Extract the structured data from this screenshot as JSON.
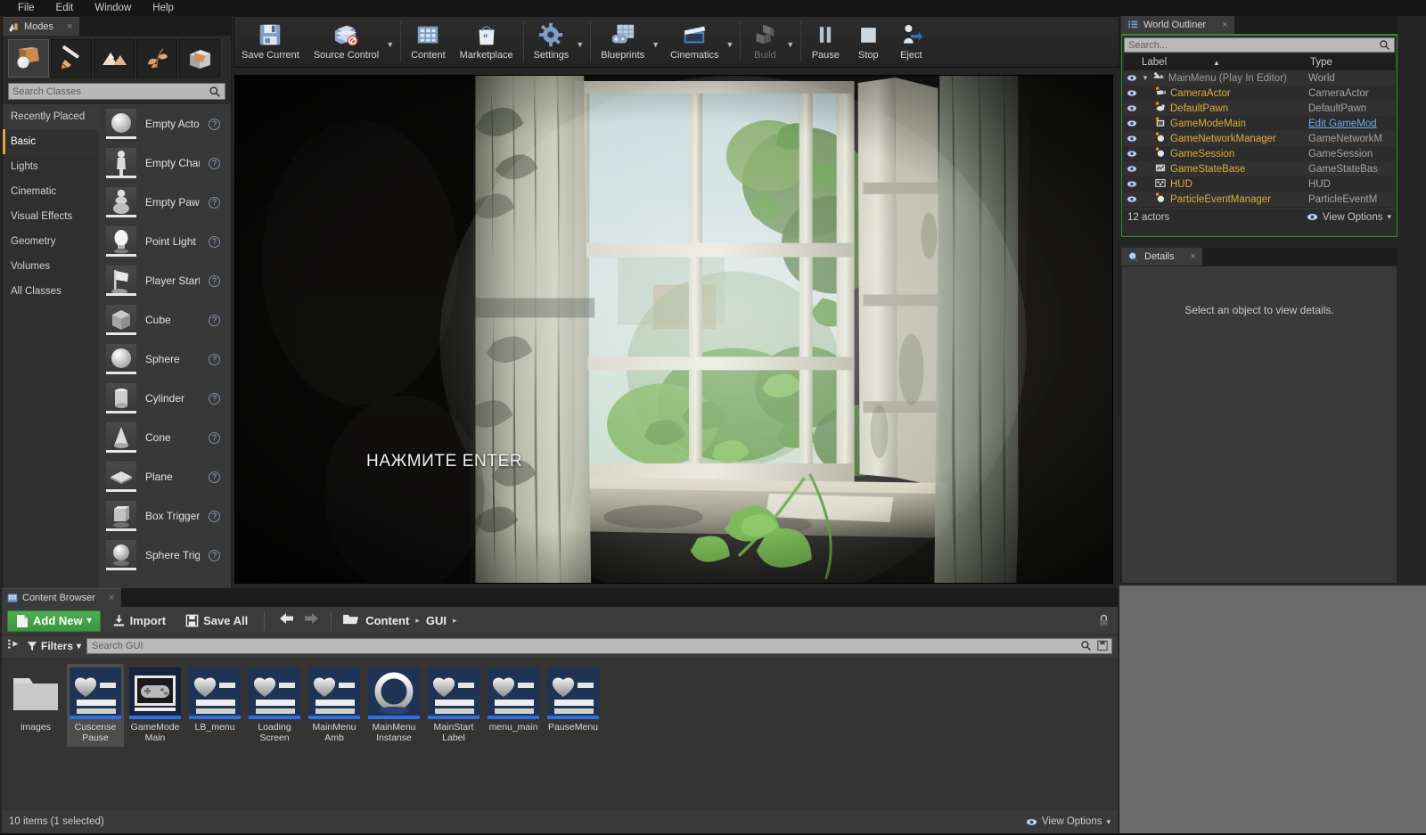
{
  "menu": {
    "items": [
      "File",
      "Edit",
      "Window",
      "Help"
    ]
  },
  "modes_panel": {
    "tab_label": "Modes",
    "tab_icon": "modes-icon",
    "close_icon": "×",
    "mode_buttons": [
      {
        "name": "place-mode",
        "icon": "cube-sphere-icon",
        "active": true
      },
      {
        "name": "paint-mode",
        "icon": "paintbrush-icon",
        "active": false
      },
      {
        "name": "landscape-mode",
        "icon": "mountain-icon",
        "active": false
      },
      {
        "name": "foliage-mode",
        "icon": "leaf-icon",
        "active": false
      },
      {
        "name": "geometry-mode",
        "icon": "brush-editing-icon",
        "active": false
      }
    ],
    "search": {
      "placeholder": "Search Classes",
      "value": "",
      "icon": "search-icon"
    },
    "categories": [
      {
        "label": "Recently Placed",
        "selected": false,
        "hover": true
      },
      {
        "label": "Basic",
        "selected": true,
        "hover": false
      },
      {
        "label": "Lights",
        "selected": false,
        "hover": false
      },
      {
        "label": "Cinematic",
        "selected": false,
        "hover": false
      },
      {
        "label": "Visual Effects",
        "selected": false,
        "hover": false
      },
      {
        "label": "Geometry",
        "selected": false,
        "hover": false
      },
      {
        "label": "Volumes",
        "selected": false,
        "hover": false
      },
      {
        "label": "All Classes",
        "selected": false,
        "hover": false
      }
    ],
    "items": [
      {
        "label": "Empty Actor",
        "icon": "sphere-thumb",
        "help": "?"
      },
      {
        "label": "Empty Charac",
        "icon": "character-thumb",
        "help": "?"
      },
      {
        "label": "Empty Pawn",
        "icon": "pawn-thumb",
        "help": "?"
      },
      {
        "label": "Point Light",
        "icon": "pointlight-thumb",
        "help": "?"
      },
      {
        "label": "Player Start",
        "icon": "playerstart-thumb",
        "help": "?"
      },
      {
        "label": "Cube",
        "icon": "cube-thumb",
        "help": "?"
      },
      {
        "label": "Sphere",
        "icon": "sphere-thumb",
        "help": "?"
      },
      {
        "label": "Cylinder",
        "icon": "cylinder-thumb",
        "help": "?"
      },
      {
        "label": "Cone",
        "icon": "cone-thumb",
        "help": "?"
      },
      {
        "label": "Plane",
        "icon": "plane-thumb",
        "help": "?"
      },
      {
        "label": "Box Trigger",
        "icon": "boxtrigger-thumb",
        "help": "?"
      },
      {
        "label": "Sphere Trigge",
        "icon": "spheretrigger-thumb",
        "help": "?"
      }
    ]
  },
  "toolbar": {
    "buttons": [
      {
        "label": "Save Current",
        "icon": "save-icon",
        "dropdown": false,
        "disabled": false
      },
      {
        "label": "Source Control",
        "icon": "source-control-icon",
        "dropdown": true,
        "disabled": false
      },
      {
        "label": "Content",
        "icon": "content-icon",
        "dropdown": false,
        "disabled": false
      },
      {
        "label": "Marketplace",
        "icon": "marketplace-icon",
        "dropdown": false,
        "disabled": false
      },
      {
        "label": "Settings",
        "icon": "settings-gear-icon",
        "dropdown": true,
        "disabled": false
      },
      {
        "label": "Blueprints",
        "icon": "blueprints-icon",
        "dropdown": true,
        "disabled": false
      },
      {
        "label": "Cinematics",
        "icon": "cinematics-clapperboard-icon",
        "dropdown": true,
        "disabled": false
      },
      {
        "label": "Build",
        "icon": "build-icon",
        "dropdown": true,
        "disabled": true
      },
      {
        "label": "Pause",
        "icon": "pause-icon",
        "dropdown": false,
        "disabled": false
      },
      {
        "label": "Stop",
        "icon": "stop-icon",
        "dropdown": false,
        "disabled": false
      },
      {
        "label": "Eject",
        "icon": "eject-icon",
        "dropdown": false,
        "disabled": false
      }
    ]
  },
  "viewport": {
    "overlay_text": "НАЖМИТЕ ENTER",
    "scene_description": "abandoned room interior with sunlit window, lace curtains and green vine leaves"
  },
  "outliner": {
    "tab_label": "World Outliner",
    "tab_icon": "outliner-list-icon",
    "close_icon": "×",
    "search": {
      "placeholder": "Search...",
      "value": "",
      "icon": "search-icon"
    },
    "columns": {
      "label": "Label",
      "type": "Type",
      "sort_caret": "▲"
    },
    "rows": [
      {
        "label": "MainMenu (Play In Editor)",
        "type": "World",
        "level": 0,
        "icon": "world-icon",
        "eye": "eye-icon",
        "type_link": false
      },
      {
        "label": "CameraActor",
        "type": "CameraActor",
        "level": 1,
        "icon": "camera-icon",
        "eye": "eye-icon",
        "type_link": false
      },
      {
        "label": "DefaultPawn",
        "type": "DefaultPawn",
        "level": 1,
        "icon": "pawn-icon",
        "eye": "eye-icon",
        "type_link": false
      },
      {
        "label": "GameModeMain",
        "type": "Edit GameMod",
        "level": 1,
        "icon": "gamemode-icon",
        "eye": "eye-icon",
        "type_link": true
      },
      {
        "label": "GameNetworkManager",
        "type": "GameNetworkM",
        "level": 1,
        "icon": "actor-icon",
        "eye": "eye-icon",
        "type_link": false
      },
      {
        "label": "GameSession",
        "type": "GameSession",
        "level": 1,
        "icon": "actor-icon",
        "eye": "eye-icon",
        "type_link": false
      },
      {
        "label": "GameStateBase",
        "type": "GameStateBas",
        "level": 1,
        "icon": "gamestate-icon",
        "eye": "eye-icon",
        "type_link": false
      },
      {
        "label": "HUD",
        "type": "HUD",
        "level": 1,
        "icon": "hud-icon",
        "eye": "eye-icon",
        "type_link": false
      },
      {
        "label": "ParticleEventManager",
        "type": "ParticleEventM",
        "level": 1,
        "icon": "actor-icon",
        "eye": "eye-icon",
        "type_link": false
      }
    ],
    "footer": {
      "count": "12 actors",
      "view_options": "View Options",
      "view_icon": "eye-icon",
      "caret": "▾"
    }
  },
  "details": {
    "tab_label": "Details",
    "tab_icon": "details-magnifier-icon",
    "close_icon": "×",
    "empty_message": "Select an object to view details."
  },
  "content_browser": {
    "tab_label": "Content Browser",
    "tab_icon": "content-browser-icon",
    "close_icon": "×",
    "add_new": {
      "label": "Add New",
      "icon": "new-file-icon",
      "caret": "▾"
    },
    "import": {
      "label": "Import",
      "icon": "import-icon"
    },
    "save_all": {
      "label": "Save All",
      "icon": "save-icon"
    },
    "nav": {
      "back_icon": "arrow-left-icon",
      "forward_icon": "arrow-right-icon",
      "folder_icon": "folder-icon"
    },
    "breadcrumbs": [
      "Content",
      "GUI"
    ],
    "breadcrumb_sep": "▸",
    "lock_icon": "lock-icon",
    "filters": {
      "label": "Filters",
      "icon": "filter-funnel-icon",
      "caret": "▾",
      "sources_icon": "sources-panel-icon"
    },
    "search": {
      "placeholder": "Search GUI",
      "value": "",
      "icon": "search-icon",
      "save_search_icon": "save-search-icon"
    },
    "assets": [
      {
        "name": "images",
        "type": "folder",
        "selected": false,
        "thumb": "folder-thumb"
      },
      {
        "name": "Cuscense Pause",
        "type": "widget",
        "selected": true,
        "thumb": "widget-heart-thumb"
      },
      {
        "name": "GameMode Main",
        "type": "blueprint",
        "selected": false,
        "thumb": "gamepad-thumb"
      },
      {
        "name": "LB_menu",
        "type": "widget",
        "selected": false,
        "thumb": "widget-heart-thumb"
      },
      {
        "name": "Loading Screen",
        "type": "widget",
        "selected": false,
        "thumb": "widget-heart-thumb"
      },
      {
        "name": "MainMenu Amb",
        "type": "widget",
        "selected": false,
        "thumb": "widget-heart-thumb"
      },
      {
        "name": "MainMenu Instanse",
        "type": "material",
        "selected": false,
        "thumb": "ring-thumb"
      },
      {
        "name": "MainStart Label",
        "type": "widget",
        "selected": false,
        "thumb": "widget-heart-thumb"
      },
      {
        "name": "menu_main",
        "type": "widget",
        "selected": false,
        "thumb": "widget-heart-thumb"
      },
      {
        "name": "PauseMenu",
        "type": "widget",
        "selected": false,
        "thumb": "widget-heart-thumb"
      }
    ],
    "status": {
      "items_text": "10 items (1 selected)",
      "view_options": "View Options",
      "view_icon": "eye-icon",
      "caret": "▾"
    }
  },
  "colors": {
    "accent_orange": "#e0a93c",
    "pie_green": "#2f8f2c",
    "add_new_green": "#4caf50",
    "link_blue": "#6fa8e8",
    "panel_bg": "#2a2a2a",
    "toolbar_bg": "#2d2d2d"
  }
}
